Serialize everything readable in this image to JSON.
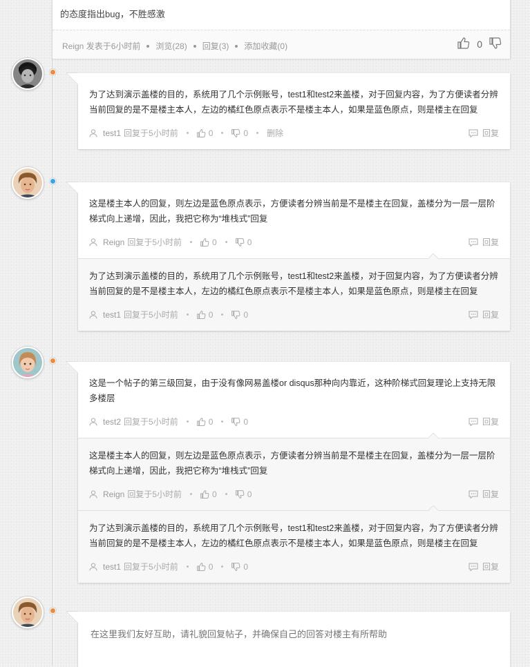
{
  "post": {
    "text": "的态度指出bug，不胜感激",
    "author": "Reign",
    "posted": "发表于6小时前",
    "views": "浏览(28)",
    "replies": "回复(3)",
    "favorite": "添加收藏(0)",
    "vote_count": "0"
  },
  "threads": [
    {
      "avatar": "bw-portrait",
      "dot_color": "orange",
      "comments": [
        {
          "text": "为了达到演示盖楼的目的，系统用了几个示例账号，test1和test2来盖楼，对于回复内容，为了方便读者分辨当前回复的是不是楼主本人，左边的橘红色原点表示不是楼主本人，如果是蓝色原点，则是楼主在回复",
          "author": "test1",
          "time": "回复于5小时前",
          "likes": "0",
          "dislikes": "0",
          "delete": "删除",
          "reply": "回复"
        }
      ]
    },
    {
      "avatar": "boy-portrait",
      "dot_color": "blue",
      "comments": [
        {
          "text": "这是楼主本人的回复，则左边是蓝色原点表示，方便读者分辨当前是不是楼主在回复，盖楼分为一层一层阶梯式向上递增，因此，我把它称为“堆栈式”回复",
          "author": "Reign",
          "time": "回复于5小时前",
          "likes": "0",
          "dislikes": "0",
          "reply": "回复"
        },
        {
          "text": "为了达到演示盖楼的目的，系统用了几个示例账号，test1和test2来盖楼，对于回复内容，为了方便读者分辨当前回复的是不是楼主本人，左边的橘红色原点表示不是楼主本人，如果是蓝色原点，则是楼主在回复",
          "author": "test1",
          "time": "回复于5小时前",
          "likes": "0",
          "dislikes": "0",
          "reply": "回复"
        }
      ]
    },
    {
      "avatar": "girl-portrait",
      "dot_color": "orange",
      "comments": [
        {
          "text": "这是一个帖子的第三级回复，由于没有像网易盖楼or disqus那种向内靠近，这种阶梯式回复理论上支持无限多楼层",
          "author": "test2",
          "time": "回复于5小时前",
          "likes": "0",
          "dislikes": "0",
          "reply": "回复"
        },
        {
          "text": "这是楼主本人的回复，则左边是蓝色原点表示，方便读者分辨当前是不是楼主在回复，盖楼分为一层一层阶梯式向上递增，因此，我把它称为“堆栈式”回复",
          "author": "Reign",
          "time": "回复于5小时前",
          "likes": "0",
          "dislikes": "0",
          "reply": "回复"
        },
        {
          "text": "为了达到演示盖楼的目的，系统用了几个示例账号，test1和test2来盖楼，对于回复内容，为了方便读者分辨当前回复的是不是楼主本人，左边的橘红色原点表示不是楼主本人，如果是蓝色原点，则是楼主在回复",
          "author": "test1",
          "time": "回复于5小时前",
          "likes": "0",
          "dislikes": "0",
          "reply": "回复"
        }
      ]
    }
  ],
  "reply_box": {
    "avatar": "boy-portrait",
    "dot_color": "orange",
    "placeholder": "在这里我们友好互助，请礼貌回复帖子，并确保自己的回答对楼主有所帮助"
  },
  "colors": {
    "orange_dot": "#f08a3c",
    "blue_dot": "#3ba4e6",
    "page_bg": "#eeeeee"
  }
}
